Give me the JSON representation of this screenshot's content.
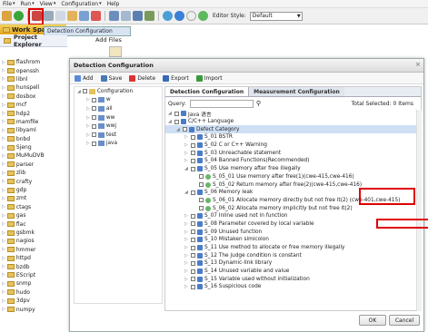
{
  "menubar": {
    "items": [
      "File",
      "Run",
      "View",
      "Configuration",
      "Help"
    ]
  },
  "toolbar": {
    "editor_style_label": "Editor Style:",
    "editor_style_value": "Default"
  },
  "tooltip": "Detection Configuration",
  "workspace_tab": "Work Spac",
  "project_explorer": "Project Explorer",
  "add_files": "Add Files",
  "projects": [
    "flashrom",
    "openssh",
    "libnl",
    "hunspell",
    "dosbox",
    "mcf",
    "hdp2",
    "mamfile",
    "libyaml",
    "bnbd",
    "Sjeng",
    "MuMuDVB",
    "parser",
    "zlib",
    "crafty",
    "gdp",
    "zmt",
    "ctags",
    "gas",
    "flac",
    "gsbmk",
    "nagios",
    "hmmer",
    "httpd",
    "bzdb",
    "EScript",
    "snmp",
    "hudo",
    "3dpv",
    "numpy"
  ],
  "dialog": {
    "title": "Detection Configuration",
    "actions": [
      "Add",
      "Save",
      "Delete",
      "Export",
      "Import"
    ],
    "left_tree": [
      {
        "label": "Configuration",
        "level": 0
      },
      {
        "label": "w",
        "level": 1
      },
      {
        "label": "all",
        "level": 1
      },
      {
        "label": "ww",
        "level": 1
      },
      {
        "label": "wwj",
        "level": 1
      },
      {
        "label": "test",
        "level": 1
      },
      {
        "label": "java",
        "level": 1
      }
    ],
    "tab_active": "Detection Configuration",
    "tab_inactive": "Measurement Configuration",
    "query_label": "Query:",
    "total_selected": "Total Selected: 0 Items",
    "right_tree": [
      {
        "label": "Java 语言",
        "level": 0
      },
      {
        "label": "C/C++ Language",
        "level": 0
      },
      {
        "label": "Defect Category",
        "level": 1,
        "selected": true
      },
      {
        "label": "S_01 BSTR",
        "level": 2
      },
      {
        "label": "S_02 C or C++ Warning",
        "level": 2
      },
      {
        "label": "S_03 Unreachable statement",
        "level": 2
      },
      {
        "label": "S_04 Banned Functions(Recommended)",
        "level": 2
      },
      {
        "label": "S_05 Use memory after free illegally",
        "level": 2
      },
      {
        "label": "S_05_01 Use memory after free(1)(cwe-415,cwe-416)",
        "level": 3,
        "leaf": true
      },
      {
        "label": "S_05_02 Return memory after free(2)(cwe-415,cwe-416)",
        "level": 3,
        "leaf": true
      },
      {
        "label": "S_06 Memory leak",
        "level": 2
      },
      {
        "label": "S_06_01 Allocate memory directly but not free it(2) (cwe-401,cwe-415)",
        "level": 3,
        "leaf": true
      },
      {
        "label": "S_06_02 Allocate memory implicitly but not free it(2)",
        "level": 3,
        "leaf": true
      },
      {
        "label": "S_07 Inline used not in function",
        "level": 2
      },
      {
        "label": "S_08 Parameter covered by local variable",
        "level": 2
      },
      {
        "label": "S_09 Unused function",
        "level": 2
      },
      {
        "label": "S_10 Mistaken simicolon",
        "level": 2
      },
      {
        "label": "S_11 Use method to allocate or free memory illegally",
        "level": 2
      },
      {
        "label": "S_12 The judge condition is constant",
        "level": 2
      },
      {
        "label": "S_13 Dynamic-link library",
        "level": 2
      },
      {
        "label": "S_14 Unused variable and value",
        "level": 2
      },
      {
        "label": "S_15 Variable used without initialization",
        "level": 2
      },
      {
        "label": "S_16 Suspicious code",
        "level": 2
      }
    ],
    "ok": "OK",
    "cancel": "Cancel"
  }
}
